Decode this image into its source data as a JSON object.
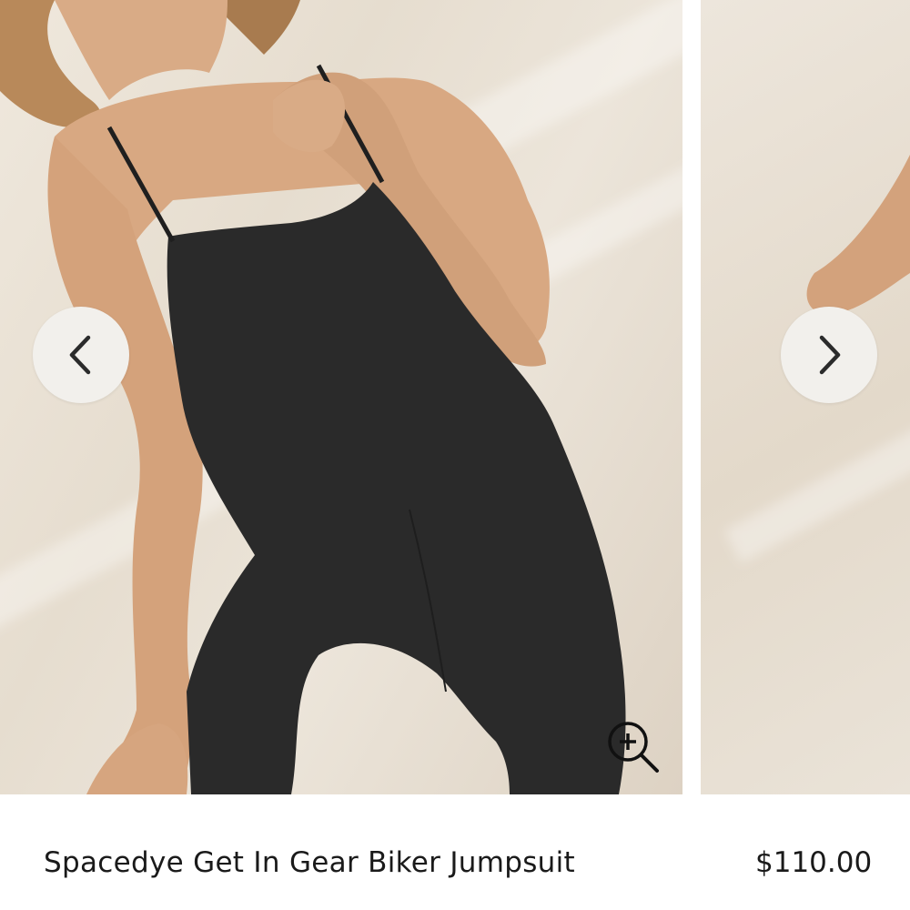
{
  "gallery": {
    "prev_icon": "chevron-left-icon",
    "next_icon": "chevron-right-icon",
    "zoom_icon": "zoom-in-icon"
  },
  "product": {
    "name": "Spacedye Get In Gear Biker Jumpsuit",
    "price": "$110.00"
  },
  "colors": {
    "backdrop": "#e8e0d4",
    "garment": "#2a2a2a",
    "skin": "#d8a882",
    "button_bg": "#f2f0ec",
    "icon": "#2b2b2b"
  }
}
